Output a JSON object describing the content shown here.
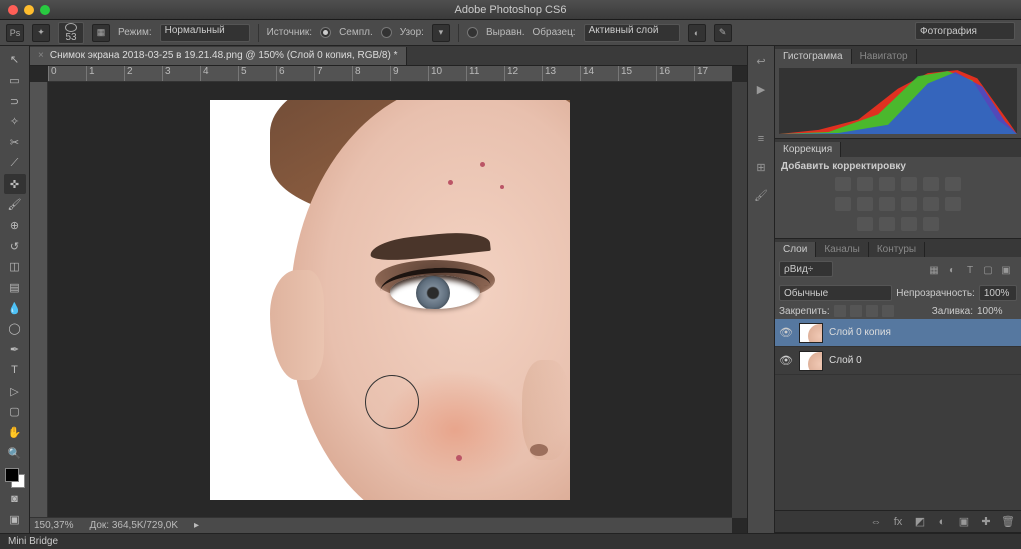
{
  "app": {
    "title": "Adobe Photoshop CS6",
    "workspace": "Фотография"
  },
  "optbar": {
    "brush_size": "53",
    "mode_label": "Режим:",
    "mode_value": "Нормальный",
    "source_label": "Источник:",
    "sampled": "Семпл.",
    "pattern": "Узор:",
    "aligned": "Выравн.",
    "sample_label": "Образец:",
    "sample_value": "Активный слой"
  },
  "doc": {
    "tab_title": "Снимок экрана 2018-03-25 в 19.21.48.png @ 150% (Слой 0 копия, RGB/8) *",
    "zoom": "150,37%",
    "docinfo": "Док: 364,5K/729,0K"
  },
  "ruler_h": [
    "0",
    "1",
    "2",
    "3",
    "4",
    "5",
    "6",
    "7",
    "8",
    "9",
    "10",
    "11",
    "12",
    "13",
    "14",
    "15",
    "16",
    "17"
  ],
  "panels": {
    "histogram": {
      "tab1": "Гистограмма",
      "tab2": "Навигатор"
    },
    "corrections": {
      "title": "Коррекция",
      "add": "Добавить корректировку"
    },
    "layers": {
      "tab1": "Слои",
      "tab2": "Каналы",
      "tab3": "Контуры",
      "kind": "Вид",
      "blend": "Обычные",
      "opacity_label": "Непрозрачность:",
      "opacity": "100%",
      "lock_label": "Закрепить:",
      "fill_label": "Заливка:",
      "fill": "100%",
      "items": [
        {
          "name": "Слой 0 копия",
          "visible": true,
          "selected": true
        },
        {
          "name": "Слой 0",
          "visible": true,
          "selected": false
        }
      ]
    }
  },
  "minibridge": "Mini Bridge"
}
